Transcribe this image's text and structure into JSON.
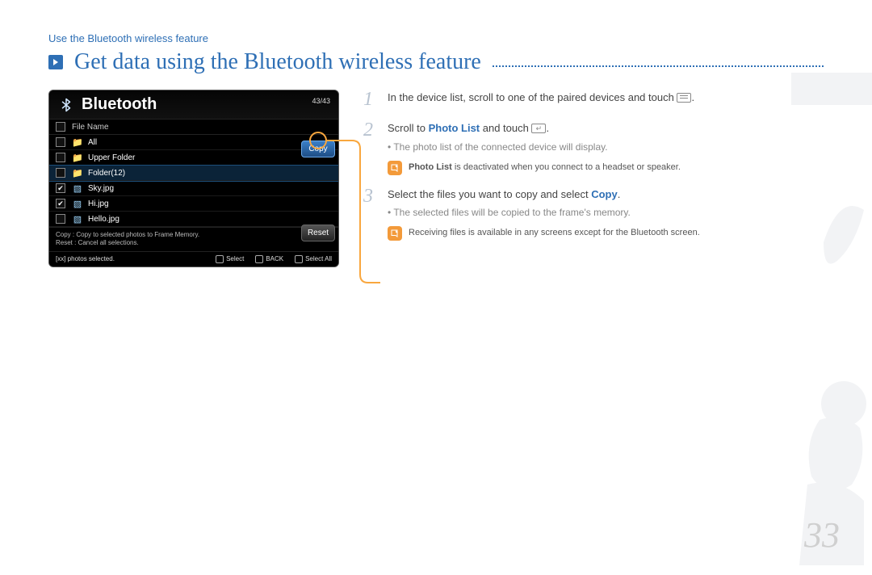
{
  "breadcrumb": "Use the Bluetooth wireless feature",
  "title": "Get data using the Bluetooth wireless feature",
  "page_number": "33",
  "screenshot": {
    "title": "Bluetooth",
    "counter": "43/43",
    "list_header": "File Name",
    "rows": [
      {
        "checked": false,
        "icon": "folder",
        "label": "All"
      },
      {
        "checked": false,
        "icon": "folder",
        "label": "Upper Folder"
      },
      {
        "checked": false,
        "icon": "folder",
        "label": "Folder(12)",
        "selected": true
      },
      {
        "checked": true,
        "icon": "img",
        "label": "Sky.jpg"
      },
      {
        "checked": true,
        "icon": "img",
        "label": "Hi.jpg"
      },
      {
        "checked": false,
        "icon": "img",
        "label": "Hello.jpg"
      }
    ],
    "btn_copy": "Copy",
    "btn_reset": "Reset",
    "note_line1": "Copy : Copy to selected photos to Frame Memory.",
    "note_line2": "Reset : Cancel all selections.",
    "status_left": "[xx] photos selected.",
    "status_select": "Select",
    "status_back": "BACK",
    "status_selectall": "Select All"
  },
  "steps": {
    "s1": {
      "num": "1",
      "text_a": "In the device list, scroll to one of the paired devices and touch ",
      "text_b": "."
    },
    "s2": {
      "num": "2",
      "text_a": "Scroll to ",
      "highlight": "Photo List",
      "text_b": " and touch ",
      "text_c": ".",
      "bullet": "The photo list of the connected device will display.",
      "note_a": "Photo List",
      "note_b": " is deactivated when you connect to a headset or speaker."
    },
    "s3": {
      "num": "3",
      "text_a": "Select the files you want to copy and select ",
      "highlight": "Copy",
      "text_b": ".",
      "bullet": "The selected files will be copied to the frame's memory.",
      "note": "Receiving files is available in any screens except for the Bluetooth screen."
    }
  }
}
